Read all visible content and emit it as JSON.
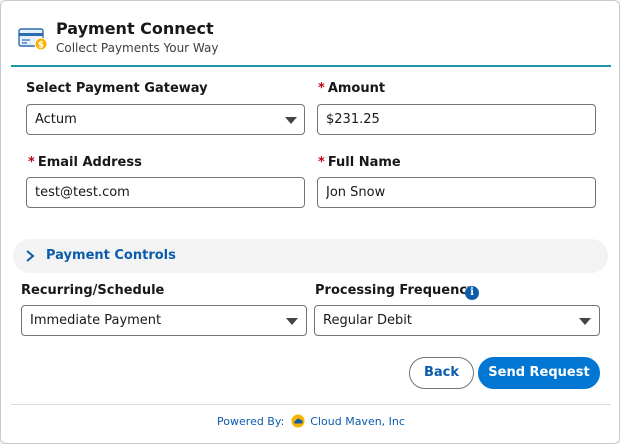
{
  "header": {
    "title": "Payment Connect",
    "subtitle": "Collect Payments Your Way",
    "icon": "credit-card-dollar-icon"
  },
  "form": {
    "gateway": {
      "label": "Select Payment Gateway",
      "value": "Actum",
      "required": false
    },
    "amount": {
      "label": "Amount",
      "value": "$231.25",
      "required": true
    },
    "email": {
      "label": "Email Address",
      "value": "test@test.com",
      "required": true
    },
    "full_name": {
      "label": "Full Name",
      "value": "Jon Snow",
      "required": true
    },
    "required_marker": "*"
  },
  "payment_controls": {
    "label": "Payment Controls",
    "icon": "chevron-right-icon",
    "recurring": {
      "label": "Recurring/Schedule",
      "value": "Immediate Payment"
    },
    "frequency": {
      "label": "Processing Frequency",
      "value": "Regular Debit",
      "info_icon": "info-icon"
    }
  },
  "actions": {
    "back_label": "Back",
    "send_label": "Send Request"
  },
  "footer": {
    "powered_by": "Powered By:",
    "company": "Cloud Maven, Inc"
  },
  "colors": {
    "accent": "#0176d3",
    "link": "#0b5cab",
    "header_rule": "#1b96a5",
    "required": "#ba0517"
  }
}
